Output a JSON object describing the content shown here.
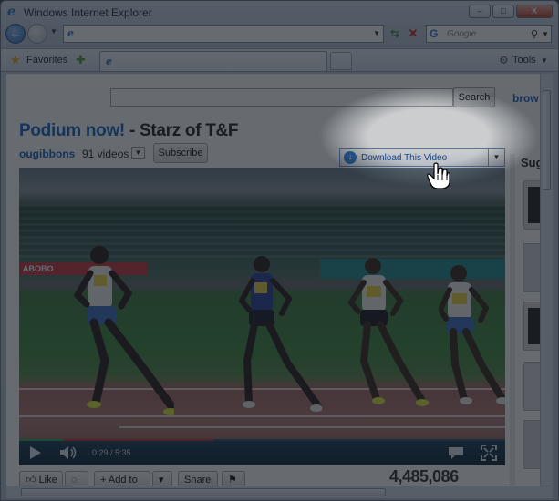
{
  "window": {
    "title": "Windows Internet Explorer",
    "controls": {
      "minimize": "–",
      "maximize": "□",
      "close": "X"
    }
  },
  "navbar": {
    "search_placeholder": "Google"
  },
  "favorites": {
    "label": "Favorites",
    "tools_label": "Tools"
  },
  "youtube": {
    "search_button": "Search",
    "browse_link": "brow",
    "title_accent": "Podium now!",
    "title_rest": " - Starz of T&F",
    "channel": "ougibbons",
    "video_count": "91 videos",
    "subscribe": "Subscribe",
    "download_button": "Download This Video",
    "player": {
      "time": "0:29 / 5:35",
      "progress": 0.09,
      "buffered": 0.4,
      "banner_text": "ABOBO"
    },
    "sidebar_title": "Sug",
    "actions": {
      "like": "Like",
      "add_to": "Add to",
      "share": "Share"
    },
    "view_count": "4,485,086"
  }
}
